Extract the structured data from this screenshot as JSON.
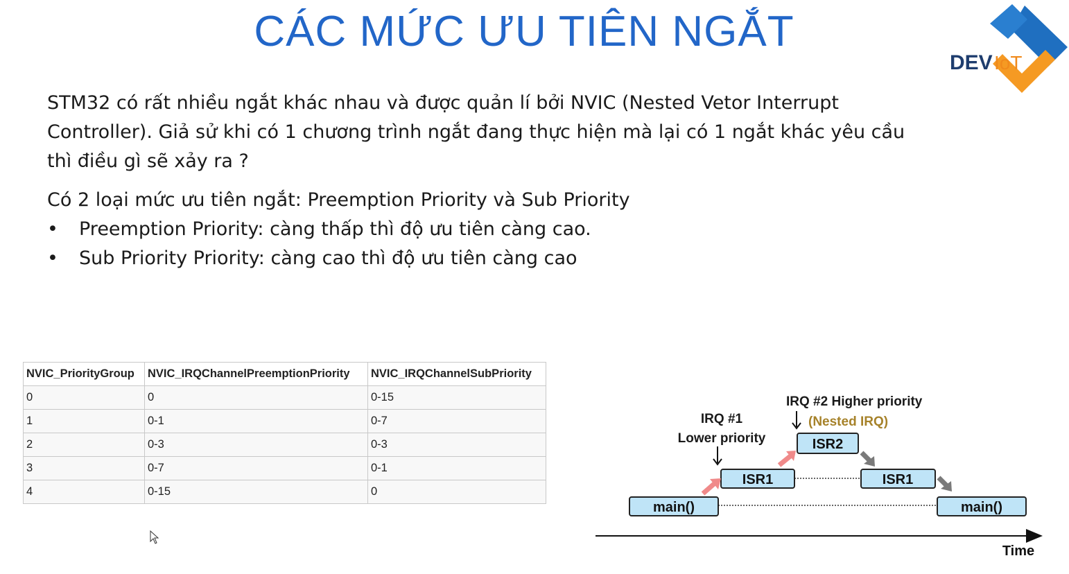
{
  "slide": {
    "title": "CÁC MỨC ƯU TIÊN NGẮT",
    "intro": "STM32 có rất nhiều ngắt khác nhau và được quản lí bởi NVIC (Nested Vetor Interrupt Controller). Giả sử khi có 1 chương trình ngắt đang thực hiện mà lại có 1 ngắt khác yêu cầu thì điều gì sẽ xảy ra ?",
    "lead": "Có 2 loại mức ưu tiên ngắt: Preemption Priority và Sub Priority",
    "bullets": [
      "Preemption Priority: càng thấp thì độ ưu tiên càng cao.",
      "Sub Priority Priority: càng cao thì độ ưu tiên càng cao"
    ]
  },
  "logo": {
    "text_dev": "DEV",
    "text_iot": "IoT",
    "colors": {
      "blue": "#1f6fc0",
      "orange": "#f59a23",
      "text": "#1e3d6e"
    }
  },
  "table": {
    "headers": [
      "NVIC_PriorityGroup",
      "NVIC_IRQChannelPreemptionPriority",
      "NVIC_IRQChannelSubPriority"
    ],
    "rows": [
      [
        "0",
        "0",
        "0-15"
      ],
      [
        "1",
        "0-1",
        "0-7"
      ],
      [
        "2",
        "0-3",
        "0-3"
      ],
      [
        "3",
        "0-7",
        "0-1"
      ],
      [
        "4",
        "0-15",
        "0"
      ]
    ]
  },
  "diagram": {
    "irq2_label": "IRQ #2 Higher priority",
    "irq2_note": "(Nested IRQ)",
    "irq1_label_line1": "IRQ #1",
    "irq1_label_line2": "Lower priority",
    "isr2": "ISR2",
    "isr1_a": "ISR1",
    "isr1_b": "ISR1",
    "main_a": "main()",
    "main_b": "main()",
    "time_label": "Time",
    "colors": {
      "box_fill": "#bfe4f7",
      "up_arrow": "#f08a8a",
      "down_arrow": "#7a7a7a",
      "nested_text": "#a6822a"
    }
  }
}
